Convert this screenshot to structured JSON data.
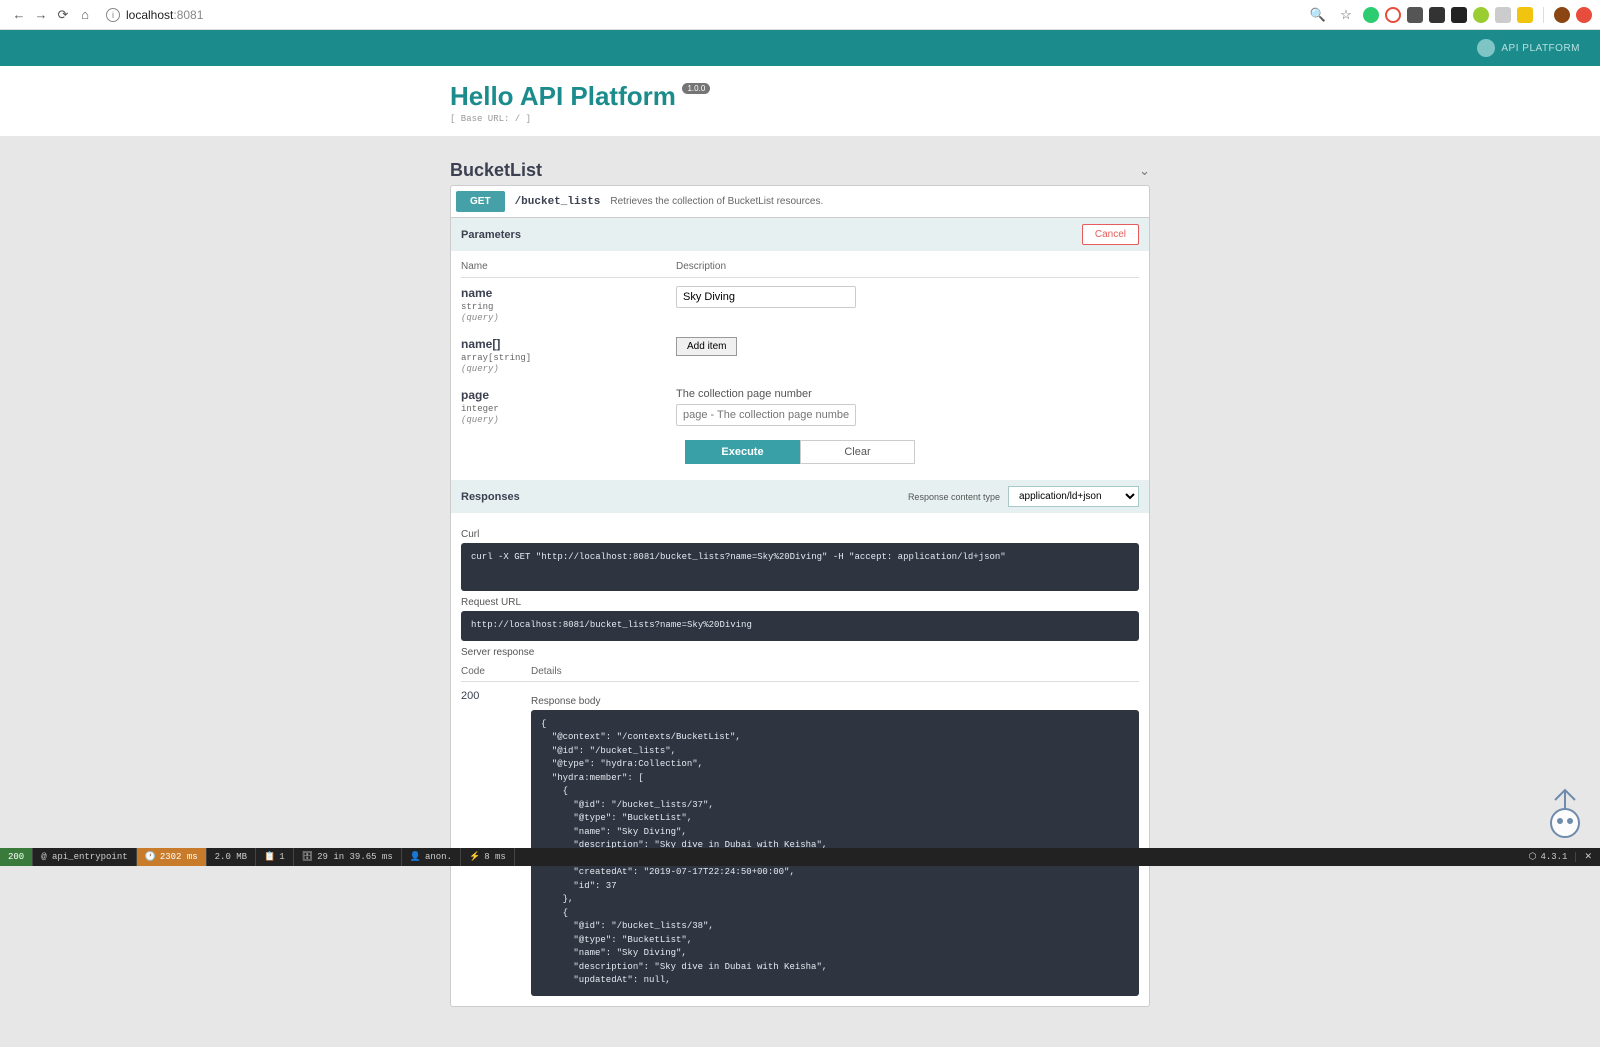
{
  "browser": {
    "url_host": "localhost",
    "url_port": ":8081"
  },
  "brand": {
    "label": "API PLATFORM"
  },
  "page": {
    "title": "Hello API Platform",
    "version": "1.0.0",
    "base_url": "[ Base URL: / ]"
  },
  "resource": {
    "name": "BucketList"
  },
  "operation": {
    "method": "GET",
    "path": "/bucket_lists",
    "summary": "Retrieves the collection of BucketList resources."
  },
  "parameters": {
    "section_label": "Parameters",
    "cancel_label": "Cancel",
    "header_name": "Name",
    "header_desc": "Description",
    "items": [
      {
        "name": "name",
        "type": "string",
        "in": "(query)",
        "control": "input",
        "value": "Sky Diving"
      },
      {
        "name": "name[]",
        "type": "array[string]",
        "in": "(query)",
        "control": "additem",
        "add_label": "Add item"
      },
      {
        "name": "page",
        "type": "integer",
        "in": "(query)",
        "control": "input",
        "desc": "The collection page number",
        "placeholder": "page - The collection page number"
      }
    ],
    "execute_label": "Execute",
    "clear_label": "Clear"
  },
  "responses": {
    "section_label": "Responses",
    "content_type_label": "Response content type",
    "content_type_value": "application/ld+json",
    "curl_label": "Curl",
    "curl_command": "curl -X GET \"http://localhost:8081/bucket_lists?name=Sky%20Diving\" -H \"accept: application/ld+json\"",
    "request_url_label": "Request URL",
    "request_url": "http://localhost:8081/bucket_lists?name=Sky%20Diving",
    "server_response_label": "Server response",
    "code_header": "Code",
    "details_header": "Details",
    "code_value": "200",
    "response_body_label": "Response body",
    "response_body": "{\n  \"@context\": \"/contexts/BucketList\",\n  \"@id\": \"/bucket_lists\",\n  \"@type\": \"hydra:Collection\",\n  \"hydra:member\": [\n    {\n      \"@id\": \"/bucket_lists/37\",\n      \"@type\": \"BucketList\",\n      \"name\": \"Sky Diving\",\n      \"description\": \"Sky dive in Dubai with Keisha\",\n      \"updatedAt\": null,\n      \"createdAt\": \"2019-07-17T22:24:50+00:00\",\n      \"id\": 37\n    },\n    {\n      \"@id\": \"/bucket_lists/38\",\n      \"@type\": \"BucketList\",\n      \"name\": \"Sky Diving\",\n      \"description\": \"Sky dive in Dubai with Keisha\",\n      \"updatedAt\": null,"
  },
  "debug": {
    "status": "200",
    "route": "@ api_entrypoint",
    "time": "2302 ms",
    "mem": "2.0 MB",
    "forms": "1",
    "db": "29 in 39.65 ms",
    "user": "anon.",
    "extra": "8 ms",
    "sf_version": "4.3.1"
  }
}
